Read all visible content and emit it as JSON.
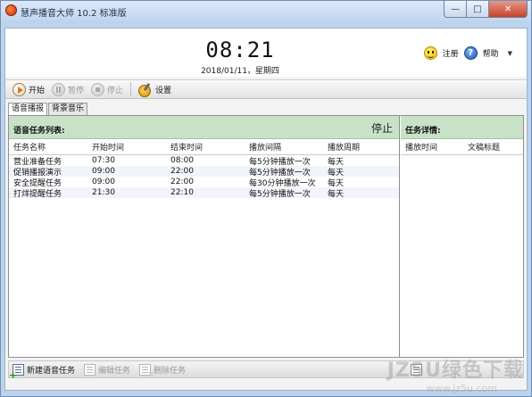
{
  "window": {
    "title": "慧声播音大师 10.2 标准版",
    "controls": {
      "minimize": "—",
      "maximize": "□",
      "close": "✕"
    }
  },
  "header": {
    "time": "08:21",
    "date": "2018/01/11，星期四",
    "register_label": "注册",
    "help_label": "帮助",
    "dropdown_glyph": "▼"
  },
  "toolbar": {
    "start_label": "开始",
    "pause_label": "暂停",
    "stop_label": "停止",
    "settings_label": "设置"
  },
  "tabs": [
    {
      "label": "语音播报",
      "active": true
    },
    {
      "label": "背景音乐",
      "active": false
    }
  ],
  "task_list": {
    "title": "语音任务列表:",
    "status": "停止",
    "columns": [
      "任务名称",
      "开始时间",
      "结束时间",
      "播放间隔",
      "播放周期"
    ],
    "rows": [
      [
        "营业准备任务",
        "07:30",
        "08:00",
        "每5分钟播放一次",
        "每天"
      ],
      [
        "促销播报演示",
        "09:00",
        "22:00",
        "每5分钟播放一次",
        "每天"
      ],
      [
        "安全提醒任务",
        "09:00",
        "22:00",
        "每30分钟播放一次",
        "每天"
      ],
      [
        "打烊提醒任务",
        "21:30",
        "22:10",
        "每5分钟播放一次",
        "每天"
      ]
    ]
  },
  "task_detail": {
    "title": "任务详情:",
    "columns": [
      "播放时间",
      "文稿标题"
    ]
  },
  "bottombar": {
    "new_label": "新建语音任务",
    "edit_label": "编辑任务",
    "delete_label": "删除任务"
  },
  "watermark": {
    "main": "JZ5U绿色下载",
    "sub": "www.jz5u.com"
  },
  "colors": {
    "panel_header": "#c8e2c8",
    "window_frame": "#bcd3ec",
    "close_button": "#c7422b"
  }
}
